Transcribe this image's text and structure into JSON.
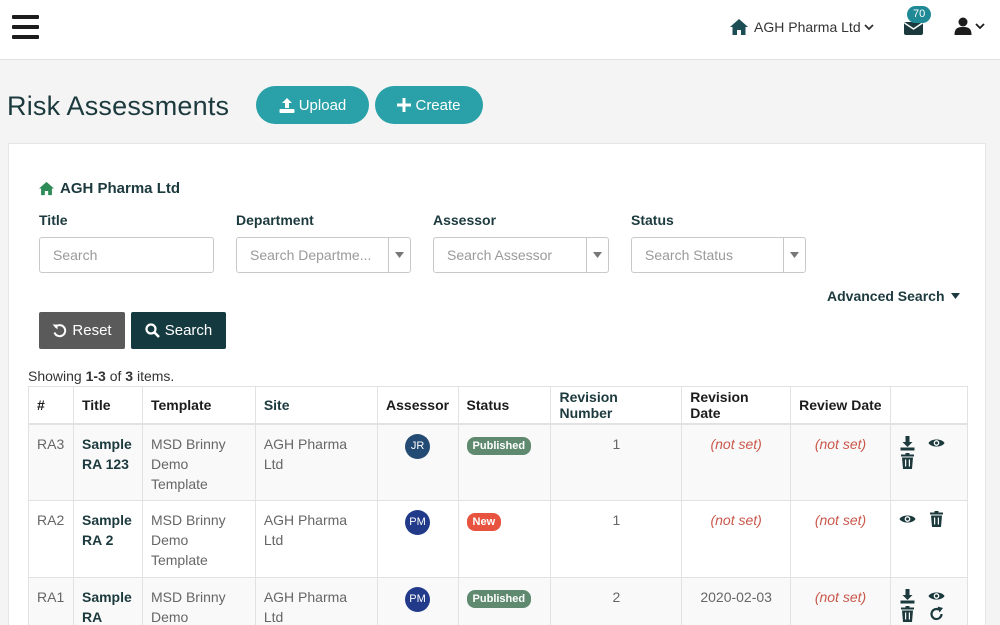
{
  "header": {
    "org_name": "AGH Pharma Ltd",
    "mail_count": "70"
  },
  "page": {
    "title": "Risk Assessments",
    "upload_label": "Upload",
    "create_label": "Create"
  },
  "filters": {
    "org_crumb": "AGH Pharma Ltd",
    "title_label": "Title",
    "title_placeholder": "Search",
    "department_label": "Department",
    "department_placeholder": "Search Departme...",
    "assessor_label": "Assessor",
    "assessor_placeholder": "Search Assessor",
    "status_label": "Status",
    "status_placeholder": "Search Status",
    "advanced_label": "Advanced Search",
    "reset_label": "Reset",
    "search_label": "Search"
  },
  "summary": {
    "prefix": "Showing ",
    "range": "1-3",
    "of": " of ",
    "total": "3",
    "suffix": " items."
  },
  "table": {
    "columns": [
      "#",
      "Title",
      "Template",
      "Site",
      "Assessor",
      "Status",
      "Revision Number",
      "Revision Date",
      "Review Date",
      ""
    ],
    "rows": [
      {
        "id": "RA3",
        "title": "Sample RA 123",
        "template": "MSD Brinny Demo Template",
        "site": "AGH Pharma Ltd",
        "assessor": "JR",
        "status": "Published",
        "revision": "1",
        "revision_date": "(not set)",
        "review_date": "(not set)"
      },
      {
        "id": "RA2",
        "title": "Sample RA 2",
        "template": "MSD Brinny Demo Template",
        "site": "AGH Pharma Ltd",
        "assessor": "PM",
        "status": "New",
        "revision": "1",
        "revision_date": "(not set)",
        "review_date": "(not set)"
      },
      {
        "id": "RA1",
        "title": "Sample RA",
        "template": "MSD Brinny Demo",
        "site": "AGH Pharma Ltd",
        "assessor": "PM",
        "status": "Published",
        "revision": "2",
        "revision_date": "2020-02-03",
        "review_date": "(not set)"
      }
    ]
  },
  "colors": {
    "accent": "#2aa1a8",
    "primary_dark": "#143a40",
    "published": "#5f8a6f",
    "new": "#e8533f",
    "not_set": "#c0392b"
  }
}
